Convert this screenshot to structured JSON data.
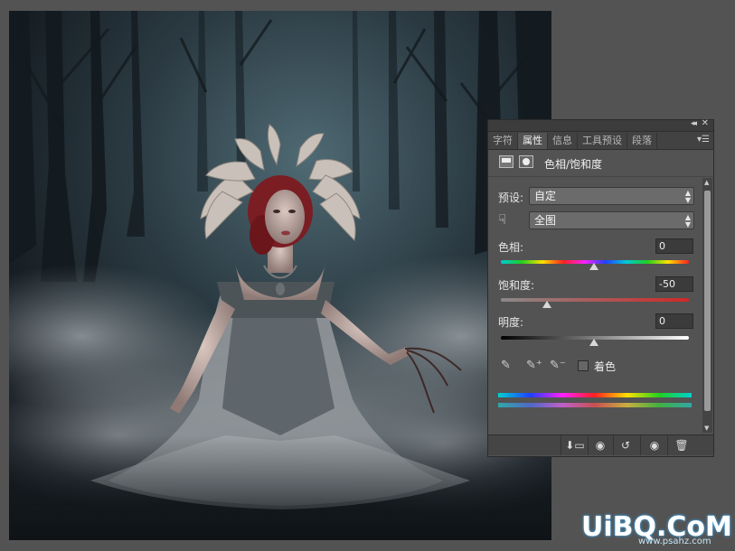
{
  "panel": {
    "tabs": [
      {
        "label": "字符",
        "active": false
      },
      {
        "label": "属性",
        "active": true
      },
      {
        "label": "信息",
        "active": false
      },
      {
        "label": "工具预设",
        "active": false
      },
      {
        "label": "段落",
        "active": false
      }
    ],
    "title": "色相/饱和度",
    "preset_label": "预设:",
    "preset_value": "自定",
    "channel_value": "全图",
    "hue": {
      "label": "色相:",
      "value": "0"
    },
    "saturation": {
      "label": "饱和度:",
      "value": "-50"
    },
    "lightness": {
      "label": "明度:",
      "value": "0"
    },
    "colorize_label": "着色",
    "colorize_checked": false,
    "icons": {
      "collapse": "double-chevron-icon",
      "close": "close-icon",
      "menu": "panel-menu-icon",
      "adjustment": "hue-saturation-adjustment-icon",
      "mask": "layer-mask-icon",
      "hand": "targeted-adjustment-hand-icon",
      "eyedropper": "eyedropper-icon",
      "eyedropper_plus": "eyedropper-add-icon",
      "eyedropper_minus": "eyedropper-subtract-icon",
      "clip": "clip-to-layer-icon",
      "view_previous": "view-previous-icon",
      "reset": "reset-icon",
      "visibility": "eye-icon",
      "delete": "trash-icon"
    }
  },
  "watermark": {
    "text": "UiBQ.CoM",
    "sub": "www.psahz.com"
  }
}
